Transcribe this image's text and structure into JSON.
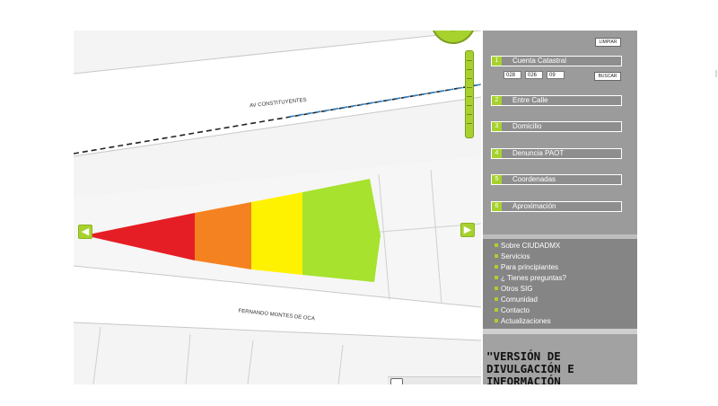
{
  "map": {
    "street_top": "AV CONSTITUYENTES",
    "street_bottom": "FERNANDO MONTES DE OCA",
    "nav_left_icon": "arrow-left-icon",
    "nav_right_icon": "arrow-right-icon",
    "cone_colors": [
      "#e51e25",
      "#f58220",
      "#fff200",
      "#a6e22e"
    ]
  },
  "panel": {
    "limpiar_label": "LIMPIAR",
    "buscar_label": "BUSCAR",
    "cuenta_catastral": [
      "028",
      "026",
      "09"
    ],
    "sections": [
      {
        "num": "1",
        "label": "Cuenta Catastral"
      },
      {
        "num": "2",
        "label": "Entre Calle"
      },
      {
        "num": "3",
        "label": "Domicilio"
      },
      {
        "num": "4",
        "label": "Denuncia PAOT"
      },
      {
        "num": "5",
        "label": "Coordenadas"
      },
      {
        "num": "6",
        "label": "Aproximación"
      }
    ],
    "links": [
      "Sobre CIUDADMX",
      "Servicios",
      "Para principiantes",
      "¿ Tienes preguntas?",
      "Otros SIG",
      "Comunidad",
      "Contacto",
      "Actualizaciones"
    ],
    "version_text": "\"VERSIÓN DE DIVULGACIÓN E INFORMACIÓN"
  },
  "colors": {
    "accent": "#a7d22e",
    "panel_gray": "#9b9b9b"
  }
}
